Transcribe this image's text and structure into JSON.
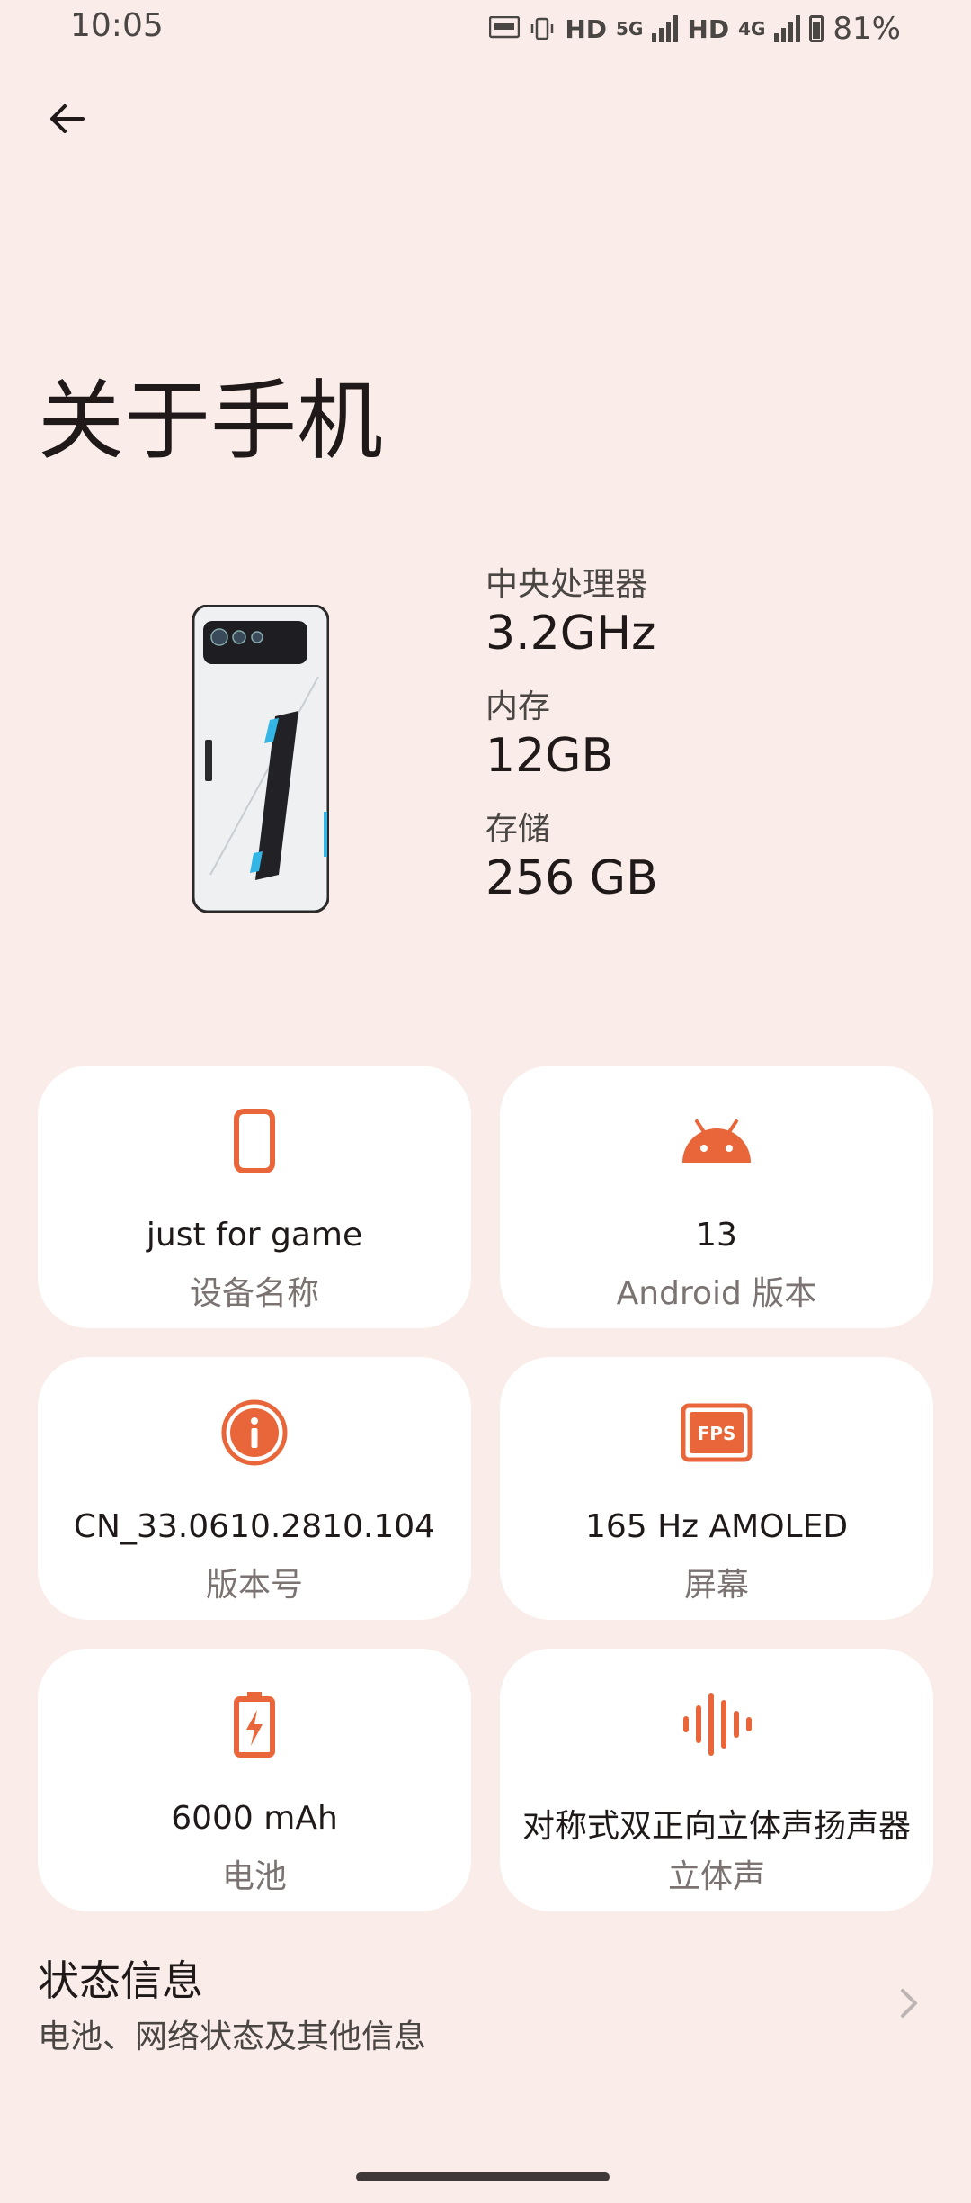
{
  "status_bar": {
    "time": "10:05",
    "icons": [
      "auto-hz-icon",
      "vibrate-icon",
      "hd-icon",
      "5g-icon",
      "signal-icon",
      "hd-icon",
      "4g-icon",
      "signal-icon",
      "battery-icon"
    ],
    "hd1": "HD",
    "net1": "5G",
    "hd2": "HD",
    "net2": "4G",
    "battery_percent": "81%"
  },
  "header": {
    "title": "关于手机"
  },
  "specs": [
    {
      "label": "中央处理器",
      "value": "3.2GHz"
    },
    {
      "label": "内存",
      "value": "12GB"
    },
    {
      "label": "存储",
      "value": "256 GB"
    }
  ],
  "cards": [
    {
      "icon": "phone-icon",
      "value": "just for game",
      "label": "设备名称"
    },
    {
      "icon": "android-icon",
      "value": "13",
      "label": "Android 版本"
    },
    {
      "icon": "info-icon",
      "value": "CN_33.0610.2810.104",
      "label": "版本号"
    },
    {
      "icon": "fps-icon",
      "value": "165 Hz AMOLED",
      "label": "屏幕",
      "icon_text": "FPS"
    },
    {
      "icon": "battery-charging-icon",
      "value": "6000 mAh",
      "label": "电池"
    },
    {
      "icon": "sound-wave-icon",
      "value": "对称式双正向立体声扬声器",
      "label": "立体声"
    }
  ],
  "status_info": {
    "title": "状态信息",
    "subtitle": "电池、网络状态及其他信息"
  },
  "colors": {
    "background": "#faece8",
    "accent": "#e8663a",
    "card": "#ffffff"
  }
}
